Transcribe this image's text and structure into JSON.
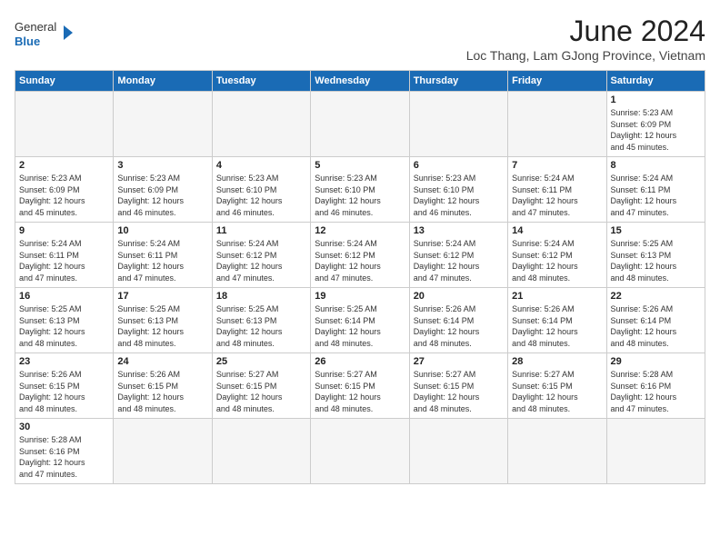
{
  "logo": {
    "general": "General",
    "blue": "Blue"
  },
  "title": "June 2024",
  "location": "Loc Thang, Lam GJong Province, Vietnam",
  "weekdays": [
    "Sunday",
    "Monday",
    "Tuesday",
    "Wednesday",
    "Thursday",
    "Friday",
    "Saturday"
  ],
  "days": [
    {
      "date": "",
      "info": ""
    },
    {
      "date": "",
      "info": ""
    },
    {
      "date": "",
      "info": ""
    },
    {
      "date": "",
      "info": ""
    },
    {
      "date": "",
      "info": ""
    },
    {
      "date": "",
      "info": ""
    },
    {
      "date": "1",
      "info": "Sunrise: 5:23 AM\nSunset: 6:09 PM\nDaylight: 12 hours\nand 45 minutes."
    },
    {
      "date": "2",
      "info": "Sunrise: 5:23 AM\nSunset: 6:09 PM\nDaylight: 12 hours\nand 45 minutes."
    },
    {
      "date": "3",
      "info": "Sunrise: 5:23 AM\nSunset: 6:09 PM\nDaylight: 12 hours\nand 46 minutes."
    },
    {
      "date": "4",
      "info": "Sunrise: 5:23 AM\nSunset: 6:10 PM\nDaylight: 12 hours\nand 46 minutes."
    },
    {
      "date": "5",
      "info": "Sunrise: 5:23 AM\nSunset: 6:10 PM\nDaylight: 12 hours\nand 46 minutes."
    },
    {
      "date": "6",
      "info": "Sunrise: 5:23 AM\nSunset: 6:10 PM\nDaylight: 12 hours\nand 46 minutes."
    },
    {
      "date": "7",
      "info": "Sunrise: 5:24 AM\nSunset: 6:11 PM\nDaylight: 12 hours\nand 47 minutes."
    },
    {
      "date": "8",
      "info": "Sunrise: 5:24 AM\nSunset: 6:11 PM\nDaylight: 12 hours\nand 47 minutes."
    },
    {
      "date": "9",
      "info": "Sunrise: 5:24 AM\nSunset: 6:11 PM\nDaylight: 12 hours\nand 47 minutes."
    },
    {
      "date": "10",
      "info": "Sunrise: 5:24 AM\nSunset: 6:11 PM\nDaylight: 12 hours\nand 47 minutes."
    },
    {
      "date": "11",
      "info": "Sunrise: 5:24 AM\nSunset: 6:12 PM\nDaylight: 12 hours\nand 47 minutes."
    },
    {
      "date": "12",
      "info": "Sunrise: 5:24 AM\nSunset: 6:12 PM\nDaylight: 12 hours\nand 47 minutes."
    },
    {
      "date": "13",
      "info": "Sunrise: 5:24 AM\nSunset: 6:12 PM\nDaylight: 12 hours\nand 47 minutes."
    },
    {
      "date": "14",
      "info": "Sunrise: 5:24 AM\nSunset: 6:12 PM\nDaylight: 12 hours\nand 48 minutes."
    },
    {
      "date": "15",
      "info": "Sunrise: 5:25 AM\nSunset: 6:13 PM\nDaylight: 12 hours\nand 48 minutes."
    },
    {
      "date": "16",
      "info": "Sunrise: 5:25 AM\nSunset: 6:13 PM\nDaylight: 12 hours\nand 48 minutes."
    },
    {
      "date": "17",
      "info": "Sunrise: 5:25 AM\nSunset: 6:13 PM\nDaylight: 12 hours\nand 48 minutes."
    },
    {
      "date": "18",
      "info": "Sunrise: 5:25 AM\nSunset: 6:13 PM\nDaylight: 12 hours\nand 48 minutes."
    },
    {
      "date": "19",
      "info": "Sunrise: 5:25 AM\nSunset: 6:14 PM\nDaylight: 12 hours\nand 48 minutes."
    },
    {
      "date": "20",
      "info": "Sunrise: 5:26 AM\nSunset: 6:14 PM\nDaylight: 12 hours\nand 48 minutes."
    },
    {
      "date": "21",
      "info": "Sunrise: 5:26 AM\nSunset: 6:14 PM\nDaylight: 12 hours\nand 48 minutes."
    },
    {
      "date": "22",
      "info": "Sunrise: 5:26 AM\nSunset: 6:14 PM\nDaylight: 12 hours\nand 48 minutes."
    },
    {
      "date": "23",
      "info": "Sunrise: 5:26 AM\nSunset: 6:15 PM\nDaylight: 12 hours\nand 48 minutes."
    },
    {
      "date": "24",
      "info": "Sunrise: 5:26 AM\nSunset: 6:15 PM\nDaylight: 12 hours\nand 48 minutes."
    },
    {
      "date": "25",
      "info": "Sunrise: 5:27 AM\nSunset: 6:15 PM\nDaylight: 12 hours\nand 48 minutes."
    },
    {
      "date": "26",
      "info": "Sunrise: 5:27 AM\nSunset: 6:15 PM\nDaylight: 12 hours\nand 48 minutes."
    },
    {
      "date": "27",
      "info": "Sunrise: 5:27 AM\nSunset: 6:15 PM\nDaylight: 12 hours\nand 48 minutes."
    },
    {
      "date": "28",
      "info": "Sunrise: 5:27 AM\nSunset: 6:15 PM\nDaylight: 12 hours\nand 48 minutes."
    },
    {
      "date": "29",
      "info": "Sunrise: 5:28 AM\nSunset: 6:16 PM\nDaylight: 12 hours\nand 47 minutes."
    },
    {
      "date": "30",
      "info": "Sunrise: 5:28 AM\nSunset: 6:16 PM\nDaylight: 12 hours\nand 47 minutes."
    },
    {
      "date": "",
      "info": ""
    },
    {
      "date": "",
      "info": ""
    },
    {
      "date": "",
      "info": ""
    },
    {
      "date": "",
      "info": ""
    },
    {
      "date": "",
      "info": ""
    },
    {
      "date": "",
      "info": ""
    }
  ]
}
